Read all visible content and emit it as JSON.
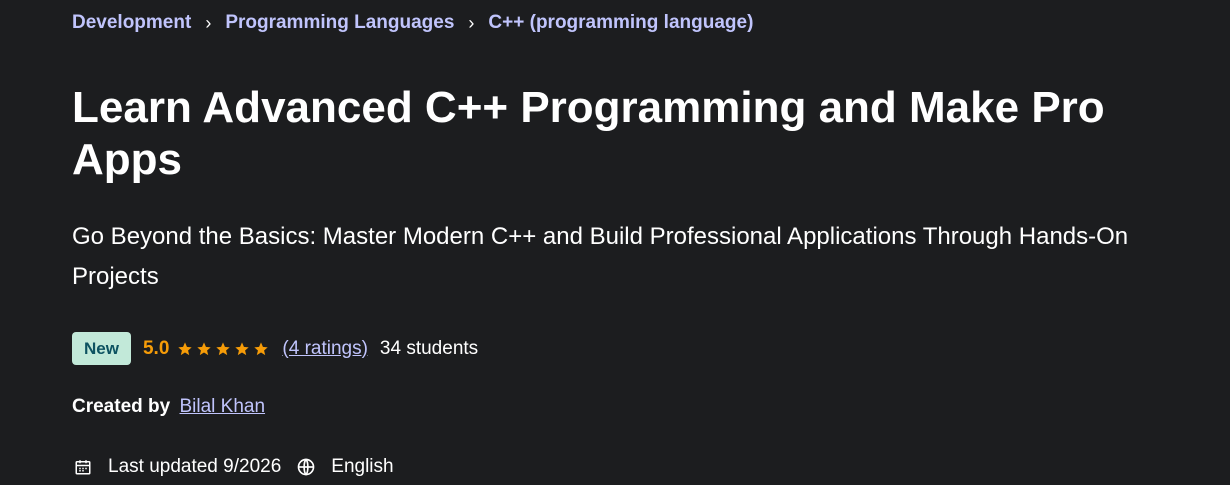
{
  "breadcrumb": {
    "items": [
      "Development",
      "Programming Languages",
      "C++ (programming language)"
    ],
    "separator": "›"
  },
  "course": {
    "title": "Learn Advanced C++ Programming and Make Pro Apps",
    "subtitle": "Go Beyond the Basics: Master Modern C++ and Build Professional Applications Through Hands-On Projects",
    "badge": "New",
    "rating": "5.0",
    "stars": 5,
    "ratings_link": "(4 ratings)",
    "students": "34 students",
    "created_by_label": "Created by",
    "instructor": "Bilal Khan",
    "last_updated": "Last updated 9/2026",
    "language": "English"
  },
  "icons": {
    "calendar": "calendar-icon",
    "globe": "globe-icon",
    "star": "star-icon"
  },
  "colors": {
    "background": "#1c1d1f",
    "link": "#c0c4fc",
    "rating": "#f69c08",
    "badge_bg": "#c2e9d9",
    "badge_text": "#0d5261"
  }
}
